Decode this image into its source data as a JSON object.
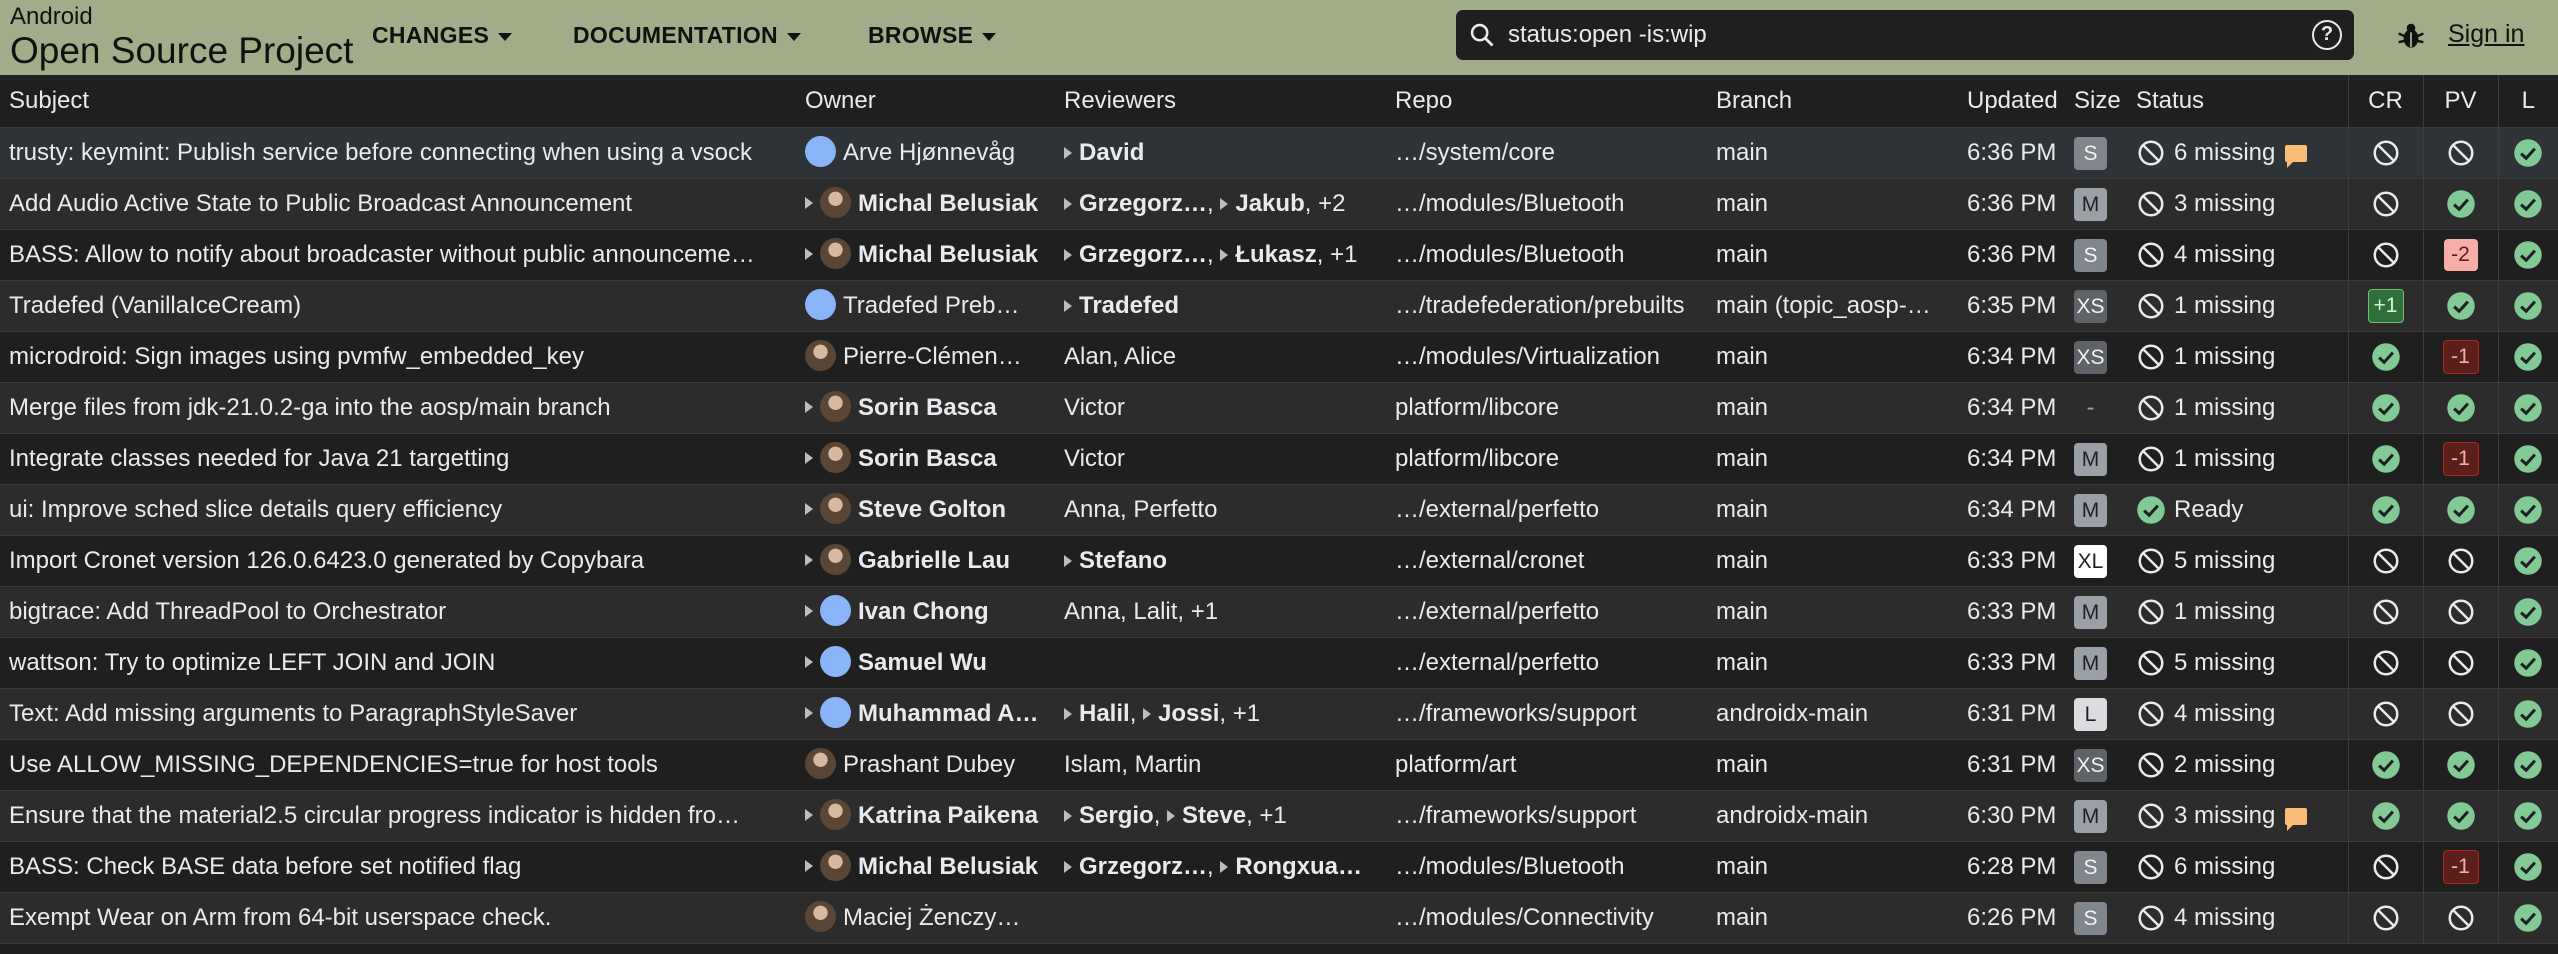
{
  "header": {
    "brand_top": "Android",
    "brand_main": "Open Source Project",
    "nav": [
      "CHANGES",
      "DOCUMENTATION",
      "BROWSE"
    ],
    "search_value": "status:open -is:wip",
    "sign_in": "Sign in"
  },
  "columns": {
    "subject": "Subject",
    "owner": "Owner",
    "reviewers": "Reviewers",
    "repo": "Repo",
    "branch": "Branch",
    "updated": "Updated",
    "size": "Size",
    "status": "Status",
    "cr": "CR",
    "pv": "PV",
    "l": "L"
  },
  "colors": {
    "header_bg": "#a1ad88",
    "ok_green": "#81c995",
    "neg_red": "#5b1f1c",
    "comment_orange": "#fbbc77"
  },
  "rows": [
    {
      "subject": "trusty: keymint: Publish service before connecting when using a vsock",
      "owner": "Arve Hjønnevåg",
      "owner_bold": false,
      "owner_attn": false,
      "avatar": "blue",
      "reviewers": [
        {
          "name": "David",
          "bold": true,
          "attn": true
        }
      ],
      "reviewers_extra": "",
      "repo": "…/system/core",
      "branch": "main",
      "updated": "6:36 PM",
      "size": "S",
      "status_icon": "block",
      "status": "6 missing",
      "comment": true,
      "cr": "block",
      "pv": "block",
      "l": "check"
    },
    {
      "subject": "Add Audio Active State to Public Broadcast Announcement",
      "owner": "Michal Belusiak",
      "owner_bold": true,
      "owner_attn": true,
      "avatar": "photo",
      "reviewers": [
        {
          "name": "Grzegorz…",
          "bold": true,
          "attn": true
        },
        {
          "name": "Jakub",
          "bold": true,
          "attn": true
        }
      ],
      "reviewers_extra": ", +2",
      "repo": "…/modules/Bluetooth",
      "branch": "main",
      "updated": "6:36 PM",
      "size": "M",
      "status_icon": "block",
      "status": "3 missing",
      "comment": false,
      "cr": "block",
      "pv": "check",
      "l": "check"
    },
    {
      "subject": "BASS: Allow to notify about broadcaster without public announceme…",
      "owner": "Michal Belusiak",
      "owner_bold": true,
      "owner_attn": true,
      "avatar": "photo",
      "reviewers": [
        {
          "name": "Grzegorz…",
          "bold": true,
          "attn": true
        },
        {
          "name": "Łukasz",
          "bold": true,
          "attn": true
        }
      ],
      "reviewers_extra": ", +1",
      "repo": "…/modules/Bluetooth",
      "branch": "main",
      "updated": "6:36 PM",
      "size": "S",
      "status_icon": "block",
      "status": "4 missing",
      "comment": false,
      "cr": "block",
      "pv": "-2",
      "l": "check"
    },
    {
      "subject": "Tradefed (VanillaIceCream)",
      "owner": "Tradefed Preb…",
      "owner_bold": false,
      "owner_attn": false,
      "avatar": "blue",
      "reviewers": [
        {
          "name": "Tradefed",
          "bold": true,
          "attn": true
        }
      ],
      "reviewers_extra": "",
      "repo": "…/tradefederation/prebuilts",
      "branch": "main (topic_aosp-…",
      "updated": "6:35 PM",
      "size": "XS",
      "status_icon": "block",
      "status": "1 missing",
      "comment": false,
      "cr": "+1",
      "pv": "check",
      "l": "check"
    },
    {
      "subject": "microdroid: Sign images using pvmfw_embedded_key",
      "owner": "Pierre-Clémen…",
      "owner_bold": false,
      "owner_attn": false,
      "avatar": "photo",
      "reviewers": [
        {
          "name": "Alan, Alice",
          "bold": false,
          "attn": false
        }
      ],
      "reviewers_extra": "",
      "repo": "…/modules/Virtualization",
      "branch": "main",
      "updated": "6:34 PM",
      "size": "XS",
      "status_icon": "block",
      "status": "1 missing",
      "comment": false,
      "cr": "check",
      "pv": "-1",
      "l": "check"
    },
    {
      "subject": "Merge files from jdk-21.0.2-ga into the aosp/main branch",
      "owner": "Sorin Basca",
      "owner_bold": true,
      "owner_attn": true,
      "avatar": "photo",
      "reviewers": [
        {
          "name": "Victor",
          "bold": false,
          "attn": false
        }
      ],
      "reviewers_extra": "",
      "repo": "platform/libcore",
      "branch": "main",
      "updated": "6:34 PM",
      "size": "-",
      "status_icon": "block",
      "status": "1 missing",
      "comment": false,
      "cr": "check",
      "pv": "check",
      "l": "check"
    },
    {
      "subject": "Integrate classes needed for Java 21 targetting",
      "owner": "Sorin Basca",
      "owner_bold": true,
      "owner_attn": true,
      "avatar": "photo",
      "reviewers": [
        {
          "name": "Victor",
          "bold": false,
          "attn": false
        }
      ],
      "reviewers_extra": "",
      "repo": "platform/libcore",
      "branch": "main",
      "updated": "6:34 PM",
      "size": "M",
      "status_icon": "block",
      "status": "1 missing",
      "comment": false,
      "cr": "check",
      "pv": "-1",
      "l": "check"
    },
    {
      "subject": "ui: Improve sched slice details query efficiency",
      "owner": "Steve Golton",
      "owner_bold": true,
      "owner_attn": true,
      "avatar": "photo",
      "reviewers": [
        {
          "name": "Anna, Perfetto",
          "bold": false,
          "attn": false
        }
      ],
      "reviewers_extra": "",
      "repo": "…/external/perfetto",
      "branch": "main",
      "updated": "6:34 PM",
      "size": "M",
      "status_icon": "check",
      "status": "Ready",
      "comment": false,
      "cr": "check",
      "pv": "check",
      "l": "check"
    },
    {
      "subject": "Import Cronet version 126.0.6423.0 generated by Copybara",
      "owner": "Gabrielle Lau",
      "owner_bold": true,
      "owner_attn": true,
      "avatar": "photo",
      "reviewers": [
        {
          "name": "Stefano",
          "bold": true,
          "attn": true
        }
      ],
      "reviewers_extra": "",
      "repo": "…/external/cronet",
      "branch": "main",
      "updated": "6:33 PM",
      "size": "XL",
      "status_icon": "block",
      "status": "5 missing",
      "comment": false,
      "cr": "block",
      "pv": "block",
      "l": "check"
    },
    {
      "subject": "bigtrace: Add ThreadPool to Orchestrator",
      "owner": "Ivan Chong",
      "owner_bold": true,
      "owner_attn": true,
      "avatar": "blue",
      "reviewers": [
        {
          "name": "Anna, Lalit, +1",
          "bold": false,
          "attn": false
        }
      ],
      "reviewers_extra": "",
      "repo": "…/external/perfetto",
      "branch": "main",
      "updated": "6:33 PM",
      "size": "M",
      "status_icon": "block",
      "status": "1 missing",
      "comment": false,
      "cr": "block",
      "pv": "block",
      "l": "check"
    },
    {
      "subject": "wattson: Try to optimize LEFT JOIN and JOIN",
      "owner": "Samuel Wu",
      "owner_bold": true,
      "owner_attn": true,
      "avatar": "blue",
      "reviewers": [],
      "reviewers_extra": "",
      "repo": "…/external/perfetto",
      "branch": "main",
      "updated": "6:33 PM",
      "size": "M",
      "status_icon": "block",
      "status": "5 missing",
      "comment": false,
      "cr": "block",
      "pv": "block",
      "l": "check"
    },
    {
      "subject": "Text: Add missing arguments to ParagraphStyleSaver",
      "owner": "Muhammad A…",
      "owner_bold": true,
      "owner_attn": true,
      "avatar": "blue",
      "reviewers": [
        {
          "name": "Halil",
          "bold": true,
          "attn": true
        },
        {
          "name": "Jossi",
          "bold": true,
          "attn": true
        }
      ],
      "reviewers_extra": ", +1",
      "repo": "…/frameworks/support",
      "branch": "androidx-main",
      "updated": "6:31 PM",
      "size": "L",
      "status_icon": "block",
      "status": "4 missing",
      "comment": false,
      "cr": "block",
      "pv": "block",
      "l": "check"
    },
    {
      "subject": "Use ALLOW_MISSING_DEPENDENCIES=true for host tools",
      "owner": "Prashant Dubey",
      "owner_bold": false,
      "owner_attn": false,
      "avatar": "photo",
      "reviewers": [
        {
          "name": "Islam, Martin",
          "bold": false,
          "attn": false
        }
      ],
      "reviewers_extra": "",
      "repo": "platform/art",
      "branch": "main",
      "updated": "6:31 PM",
      "size": "XS",
      "status_icon": "block",
      "status": "2 missing",
      "comment": false,
      "cr": "check",
      "pv": "check",
      "l": "check"
    },
    {
      "subject": "Ensure that the material2.5 circular progress indicator is hidden fro…",
      "owner": "Katrina Paikena",
      "owner_bold": true,
      "owner_attn": true,
      "avatar": "photo",
      "reviewers": [
        {
          "name": "Sergio",
          "bold": true,
          "attn": true
        },
        {
          "name": "Steve",
          "bold": true,
          "attn": true
        }
      ],
      "reviewers_extra": ", +1",
      "repo": "…/frameworks/support",
      "branch": "androidx-main",
      "updated": "6:30 PM",
      "size": "M",
      "status_icon": "block",
      "status": "3 missing",
      "comment": true,
      "cr": "check",
      "pv": "check",
      "l": "check"
    },
    {
      "subject": "BASS: Check BASE data before set notified flag",
      "owner": "Michal Belusiak",
      "owner_bold": true,
      "owner_attn": true,
      "avatar": "photo",
      "reviewers": [
        {
          "name": "Grzegorz…",
          "bold": true,
          "attn": true
        },
        {
          "name": "Rongxua…",
          "bold": true,
          "attn": true
        }
      ],
      "reviewers_extra": "",
      "repo": "…/modules/Bluetooth",
      "branch": "main",
      "updated": "6:28 PM",
      "size": "S",
      "status_icon": "block",
      "status": "6 missing",
      "comment": false,
      "cr": "block",
      "pv": "-1",
      "l": "check"
    },
    {
      "subject": "Exempt Wear on Arm from 64-bit userspace check.",
      "owner": "Maciej Żenczy…",
      "owner_bold": false,
      "owner_attn": false,
      "avatar": "photo",
      "reviewers": [],
      "reviewers_extra": "",
      "repo": "…/modules/Connectivity",
      "branch": "main",
      "updated": "6:26 PM",
      "size": "S",
      "status_icon": "block",
      "status": "4 missing",
      "comment": false,
      "cr": "block",
      "pv": "block",
      "l": "check"
    }
  ]
}
